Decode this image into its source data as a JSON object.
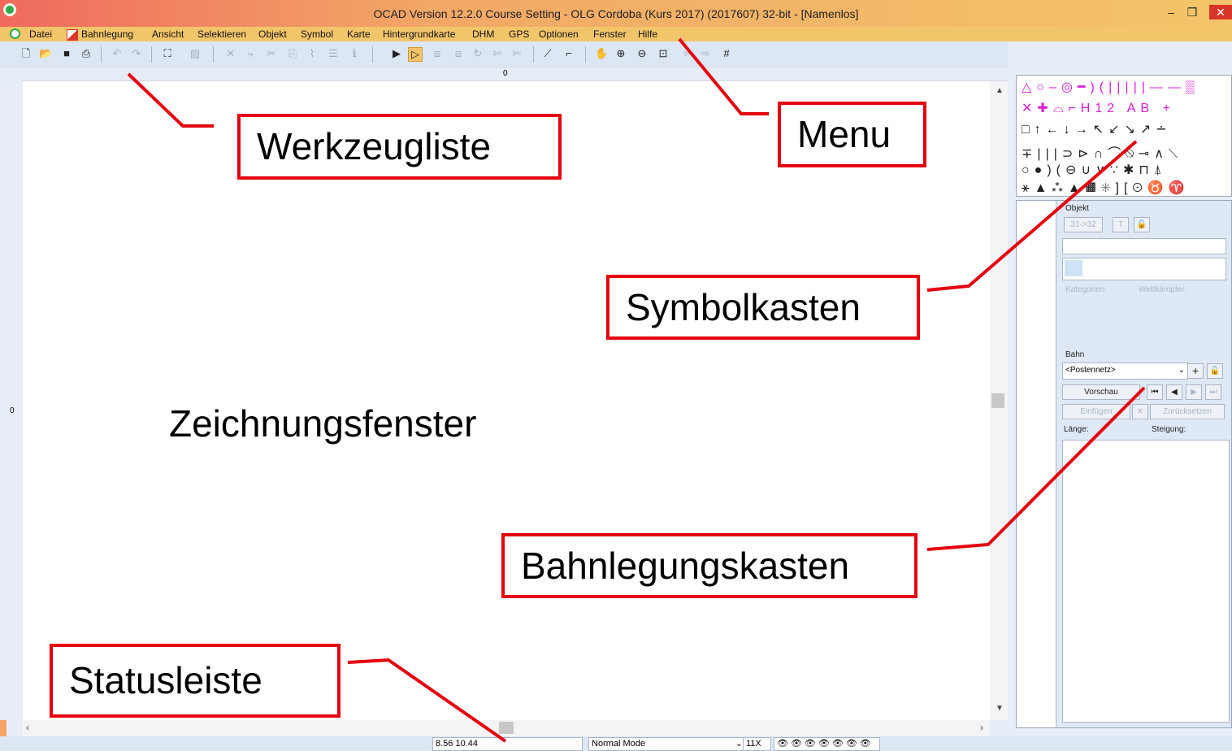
{
  "window": {
    "title": "OCAD Version 12.2.0  Course Setting - OLG Cordoba (Kurs 2017) (2017607) 32-bit - [Namenlos]",
    "minimize_glyph": "–",
    "restore_glyph": "❐",
    "close_glyph": "✕"
  },
  "menu": {
    "items": [
      "Datei",
      "Bahnlegung",
      "Ansicht",
      "Selektieren",
      "Objekt",
      "Symbol",
      "Karte",
      "Hintergrundkarte",
      "DHM",
      "GPS",
      "Optionen",
      "Fenster",
      "Hilfe"
    ]
  },
  "toolbar": {
    "icons": [
      "new-icon",
      "open-icon",
      "save-icon",
      "print-icon",
      "undo-icon",
      "redo-icon",
      "fullscreen-icon",
      "edit-icon",
      "delete-icon",
      "cut-icon",
      "move-icon",
      "copy-icon",
      "graph-icon",
      "info-icon",
      "select-icon",
      "select-edit-icon",
      "zoom-hand-icon",
      "zoom-in-icon",
      "zoom-out-icon",
      "zoom-fit-icon",
      "grid-icon"
    ]
  },
  "rulers": {
    "top_zero": "0",
    "left_zero": "0"
  },
  "course_panel": {
    "objekt_label": "Objekt",
    "range_button": "31->32",
    "t_button": "T",
    "kategorien_label": "Kategorien:",
    "wettkaempfer_label": "Wettkämpfer:",
    "bahn_label": "Bahn",
    "course_select": "<Postennetz>",
    "vorschau_button": "Vorschau",
    "einfuegen_button": "Einfügen",
    "zuruecksetzen_button": "Zurücksetzen",
    "laenge_label": "Länge:",
    "steigung_label": "Steigung:"
  },
  "status_bar": {
    "coordinates": "8.56  10.44",
    "mode": "Normal Mode",
    "zoom": "11X"
  },
  "annotations": {
    "werkzeugliste": "Werkzeugliste",
    "menu": "Menu",
    "symbolkasten": "Symbolkasten",
    "zeichnungsfenster": "Zeichnungsfenster",
    "bahnlegungskasten": "Bahnlegungskasten",
    "statusleiste": "Statusleiste"
  },
  "colors": {
    "annotation_border": "#e4000f",
    "titlebar": "#f3c56a"
  }
}
